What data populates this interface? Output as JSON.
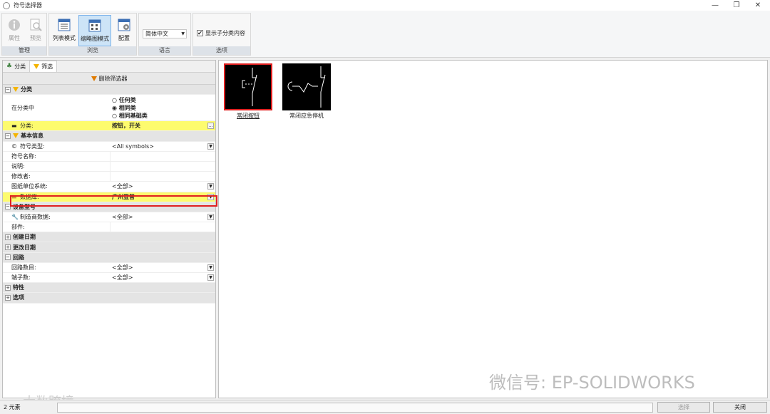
{
  "window": {
    "title": "符号选择器",
    "min": "—",
    "restore": "❐",
    "close": "✕"
  },
  "ribbon": {
    "groups": {
      "manage": {
        "label": "管理",
        "buttons": [
          "属性",
          "预览"
        ]
      },
      "browse": {
        "label": "浏览",
        "buttons": [
          "列表模式",
          "缩略图模式",
          "配置"
        ]
      },
      "language": {
        "label": "语言",
        "value": "简体中文"
      },
      "options": {
        "label": "选项",
        "checkbox_label": "显示子分类内容",
        "checked": true
      }
    }
  },
  "leftpanel": {
    "tabs": [
      "分类",
      "筛选"
    ],
    "remove_filter": "删除筛选器",
    "categories": {
      "classification": "分类",
      "in_category": "在分类中",
      "radio_options": [
        "任何类",
        "相同类",
        "相同基础类"
      ],
      "radio_selected": 1,
      "class_key": "分类:",
      "class_value": "按钮，开关",
      "basic_info": "基本信息",
      "symbol_type_key": "符号类型:",
      "symbol_type_value": "<All symbols>",
      "symbol_name_key": "符号名称:",
      "desc_key": "说明:",
      "modifier_key": "修改者:",
      "unit_system_key": "图纸单位系统:",
      "unit_system_value": "<全部>",
      "database_key": "数据库:",
      "database_value": "广州登普",
      "device_model": "设备型号",
      "manufacturer_key": "制造商数据:",
      "manufacturer_value": "<全部>",
      "part_key": "部件:",
      "created_date": "创建日期",
      "modified_date": "更改日期",
      "circuit": "回路",
      "circuit_count_key": "回路数目:",
      "circuit_count_value": "<全部>",
      "terminal_count_key": "端子数:",
      "terminal_count_value": "<全部>",
      "properties": "特性",
      "options": "选项"
    }
  },
  "thumbnails": [
    {
      "caption": "常闭按钮",
      "selected": true
    },
    {
      "caption": "常闭应急停机",
      "selected": false
    }
  ],
  "watermark": {
    "main": "微信号: EP-SOLIDWORKS",
    "corner": "大数跨境"
  },
  "statusbar": {
    "text": "2 元素",
    "select_btn": "选择",
    "close_btn": "关闭"
  },
  "colors": {
    "highlight": "#fdfb6e",
    "red_border": "#e02020",
    "selected_tab": "#cde4f7"
  }
}
